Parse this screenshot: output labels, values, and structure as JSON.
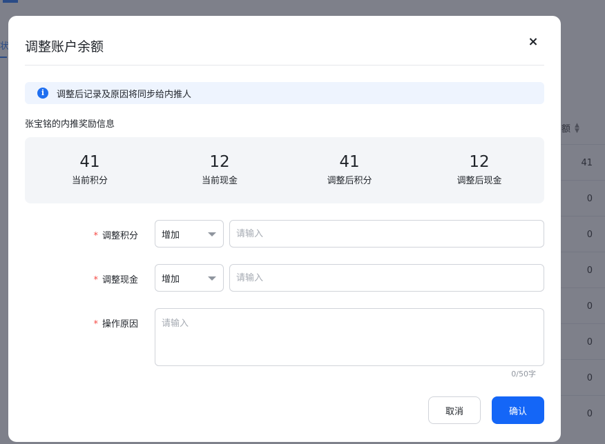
{
  "background": {
    "side_text": "状",
    "column_header": "额",
    "column_values": [
      "41",
      "0",
      "0",
      "0",
      "0",
      "0",
      "0",
      "0"
    ]
  },
  "dialog": {
    "title": "调整账户余额",
    "close_symbol": "×",
    "notice": "调整后记录及原因将同步给内推人",
    "section_title": "张宝铭的内推奖励信息",
    "stats": [
      {
        "value": "41",
        "label": "当前积分"
      },
      {
        "value": "12",
        "label": "当前现金"
      },
      {
        "value": "41",
        "label": "调整后积分"
      },
      {
        "value": "12",
        "label": "调整后现金"
      }
    ],
    "form": {
      "points": {
        "label": "调整积分",
        "select_value": "增加",
        "placeholder": "请输入"
      },
      "cash": {
        "label": "调整现金",
        "select_value": "增加",
        "placeholder": "请输入"
      },
      "reason": {
        "label": "操作原因",
        "placeholder": "请输入",
        "counter": "0/50字"
      },
      "required_mark": "*"
    },
    "buttons": {
      "cancel": "取消",
      "confirm": "确认"
    }
  },
  "colors": {
    "primary": "#1466f7",
    "required": "#f54a45",
    "overlay": "rgba(40,44,60,0.60)"
  }
}
